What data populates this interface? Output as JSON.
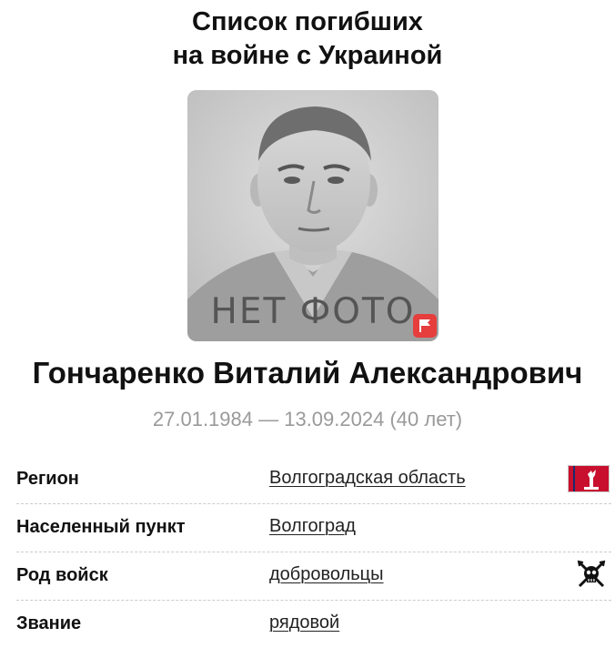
{
  "header": {
    "title_line1": "Список погибших",
    "title_line2": "на войне с Украиной"
  },
  "photo": {
    "placeholder_text": "НЕТ ФОТО",
    "report_icon": "flag-icon",
    "report_icon_color": "#e63d3d"
  },
  "person": {
    "full_name": "Гончаренко Виталий Александрович",
    "dates": "27.01.1984 — 13.09.2024 (40 лет)"
  },
  "details": [
    {
      "label": "Регион",
      "value": "Волгоградская область",
      "icon": "region-emblem-icon"
    },
    {
      "label": "Населенный пункт",
      "value": "Волгоград",
      "icon": ""
    },
    {
      "label": "Род войск",
      "value": "добровольцы",
      "icon": "volunteer-skull-icon"
    },
    {
      "label": "Звание",
      "value": "рядовой",
      "icon": ""
    }
  ],
  "colors": {
    "title": "#111111",
    "dates": "#9a9a9a",
    "flag": "#e63d3d",
    "emblem_red": "#c8102e",
    "divider": "#cccccc"
  }
}
